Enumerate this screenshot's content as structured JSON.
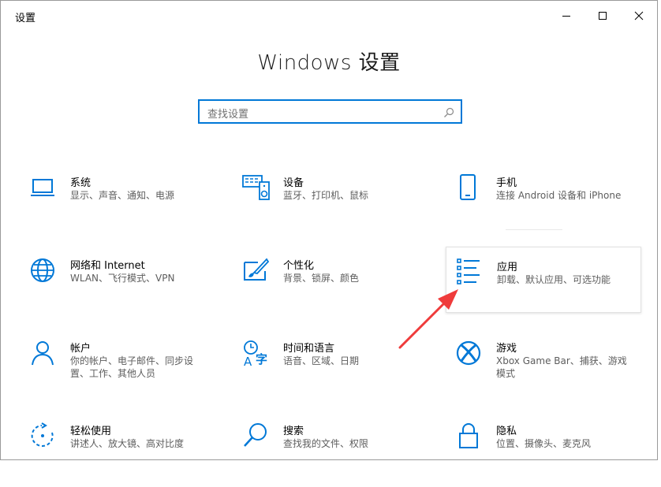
{
  "window": {
    "app_title": "设置",
    "controls": {
      "minimize": "minimize-icon",
      "maximize": "maximize-icon",
      "close": "close-icon"
    }
  },
  "heading": "Windows 设置",
  "search": {
    "placeholder": "查找设置",
    "icon": "search-icon"
  },
  "accent_color": "#0078d7",
  "tiles": [
    {
      "title": "系统",
      "desc": "显示、声音、通知、电源",
      "icon": "laptop-icon"
    },
    {
      "title": "设备",
      "desc": "蓝牙、打印机、鼠标",
      "icon": "keyboard-speaker-icon"
    },
    {
      "title": "手机",
      "desc": "连接 Android 设备和 iPhone",
      "icon": "phone-icon"
    },
    {
      "title": "网络和 Internet",
      "desc": "WLAN、飞行模式、VPN",
      "icon": "globe-icon"
    },
    {
      "title": "个性化",
      "desc": "背景、锁屏、颜色",
      "icon": "paint-icon"
    },
    {
      "title": "应用",
      "desc": "卸载、默认应用、可选功能",
      "icon": "apps-list-icon"
    },
    {
      "title": "帐户",
      "desc": "你的帐户、电子邮件、同步设置、工作、其他人员",
      "icon": "person-icon"
    },
    {
      "title": "时间和语言",
      "desc": "语音、区域、日期",
      "icon": "time-language-icon"
    },
    {
      "title": "游戏",
      "desc": "Xbox Game Bar、捕获、游戏模式",
      "icon": "xbox-icon"
    },
    {
      "title": "轻松使用",
      "desc": "讲述人、放大镜、高对比度",
      "icon": "ease-of-access-icon"
    },
    {
      "title": "搜索",
      "desc": "查找我的文件、权限",
      "icon": "search-tile-icon"
    },
    {
      "title": "隐私",
      "desc": "位置、摄像头、麦克风",
      "icon": "lock-icon"
    }
  ]
}
